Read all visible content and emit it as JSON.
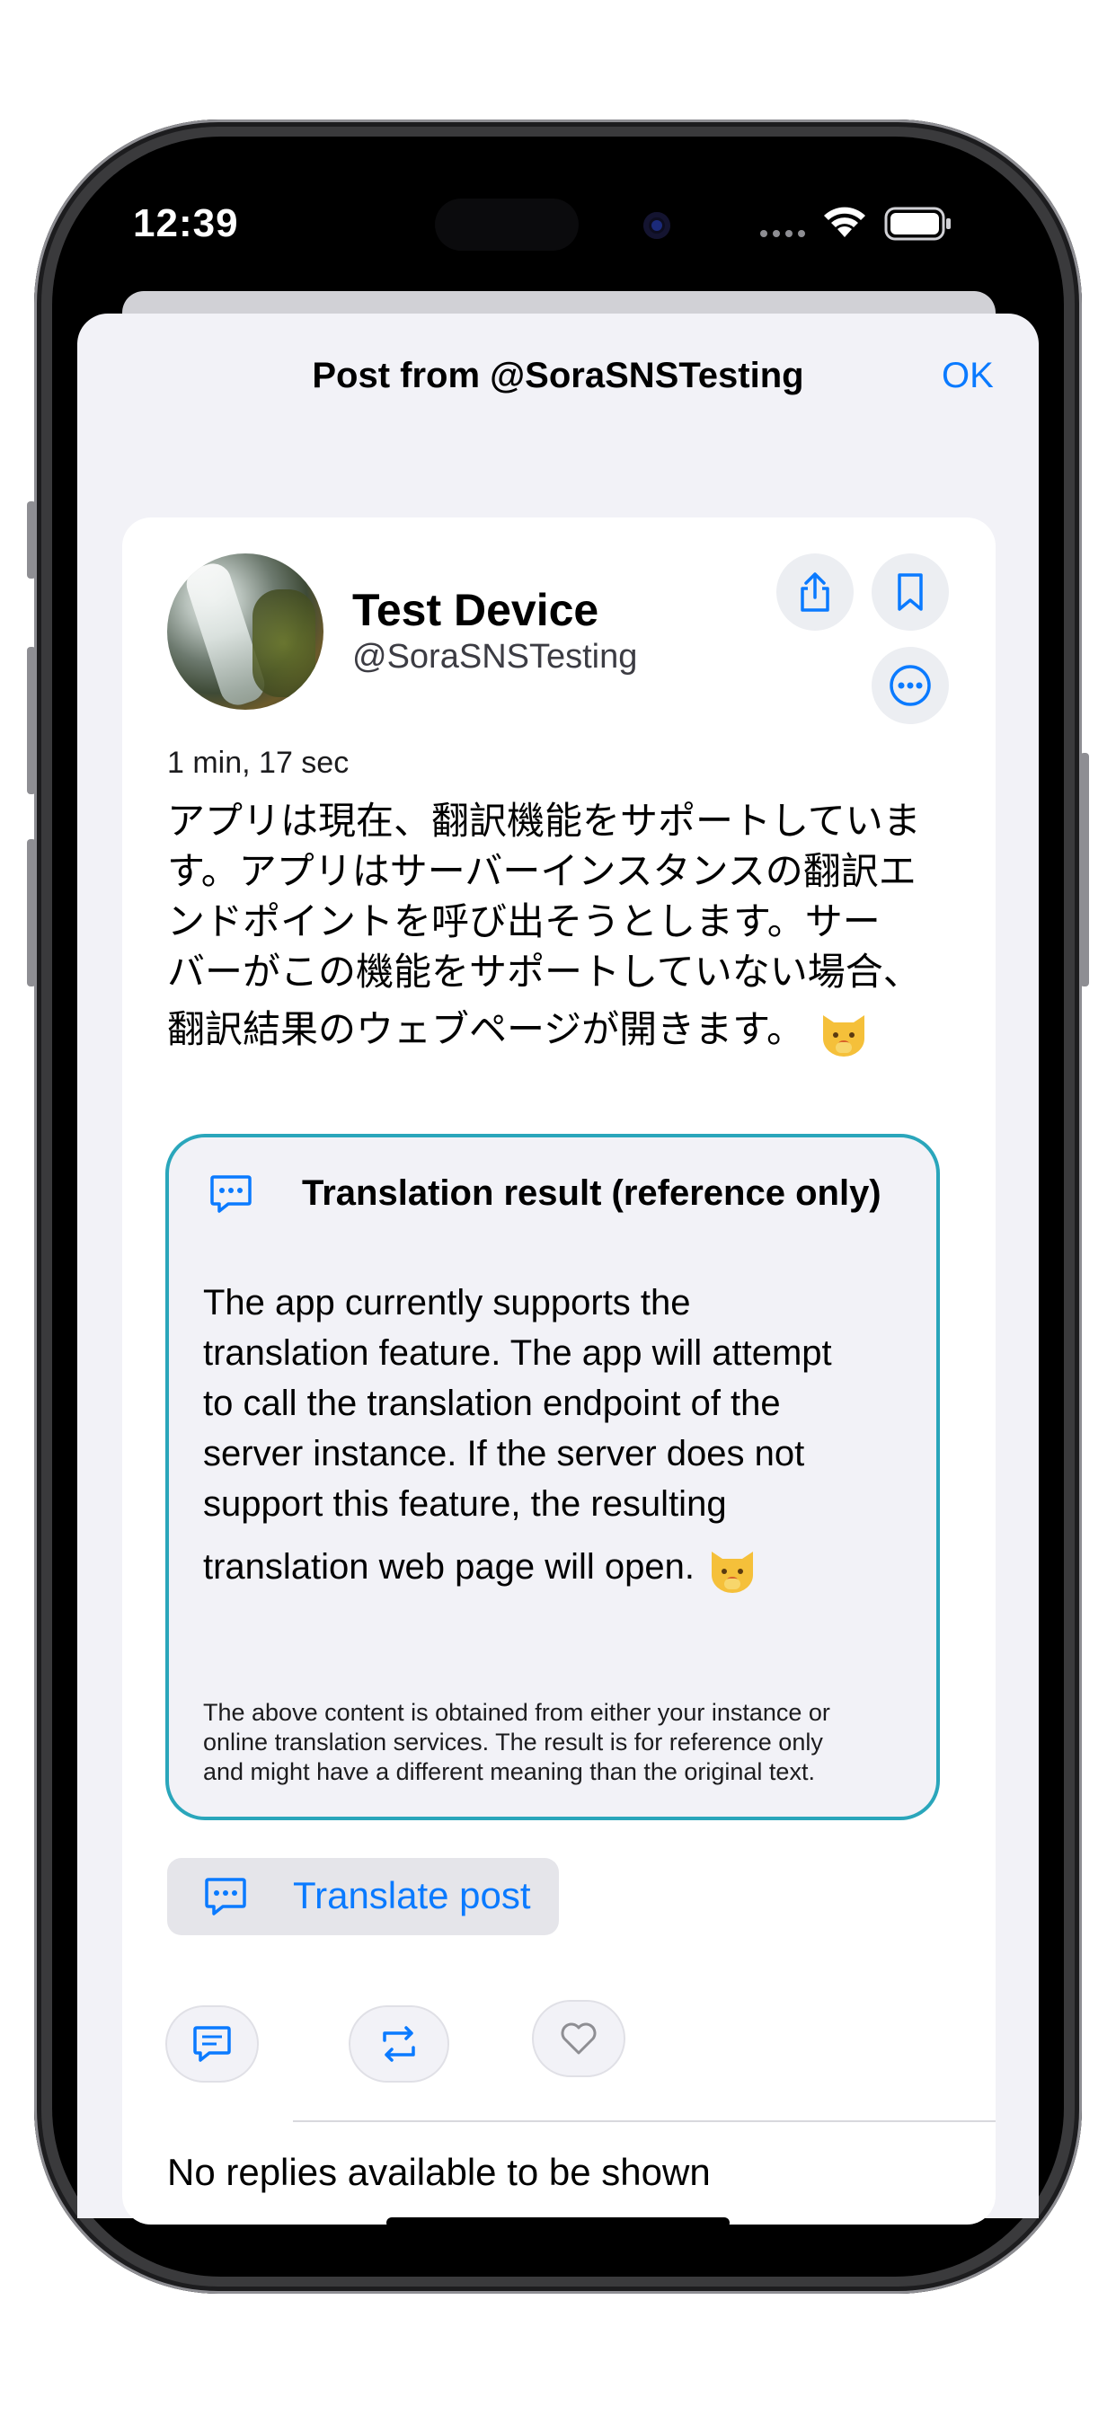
{
  "status_bar": {
    "time": "12:39"
  },
  "sheet": {
    "title": "Post from @SoraSNSTesting",
    "ok_label": "OK"
  },
  "post": {
    "display_name": "Test Device",
    "handle": "@SoraSNSTesting",
    "time_ago": "1 min, 17 sec",
    "text_lines": [
      "アプリは現在、翻訳機能をサポートしていま",
      "す。アプリはサーバーインスタンスの翻訳エ",
      "ンドポイントを呼び出そうとします。サー",
      "バーがこの機能をサポートしていない場合、",
      "翻訳結果のウェブページが開きます。"
    ]
  },
  "translation": {
    "title": "Translation result (reference only)",
    "text_lines": [
      "The app currently supports the",
      "translation feature. The app will attempt",
      "to call the translation endpoint of the",
      "server instance. If the server does not",
      "support this feature, the resulting",
      "translation web page will open."
    ],
    "note_lines": [
      "The above content is obtained from either your instance or",
      "online translation services. The result is for reference only",
      "and might have a different meaning than the original text."
    ]
  },
  "translate_button": {
    "label": "Translate post"
  },
  "replies": {
    "empty_text": "No replies available to be shown"
  },
  "icons": {
    "share": "share-icon",
    "bookmark": "bookmark-icon",
    "more": "ellipsis-circle-icon",
    "translation": "speech-bubble-icon",
    "reply": "reply-icon",
    "repost": "repost-icon",
    "like": "heart-icon"
  },
  "colors": {
    "accent": "#0a7aff",
    "translation_border": "#2aa6bb"
  }
}
